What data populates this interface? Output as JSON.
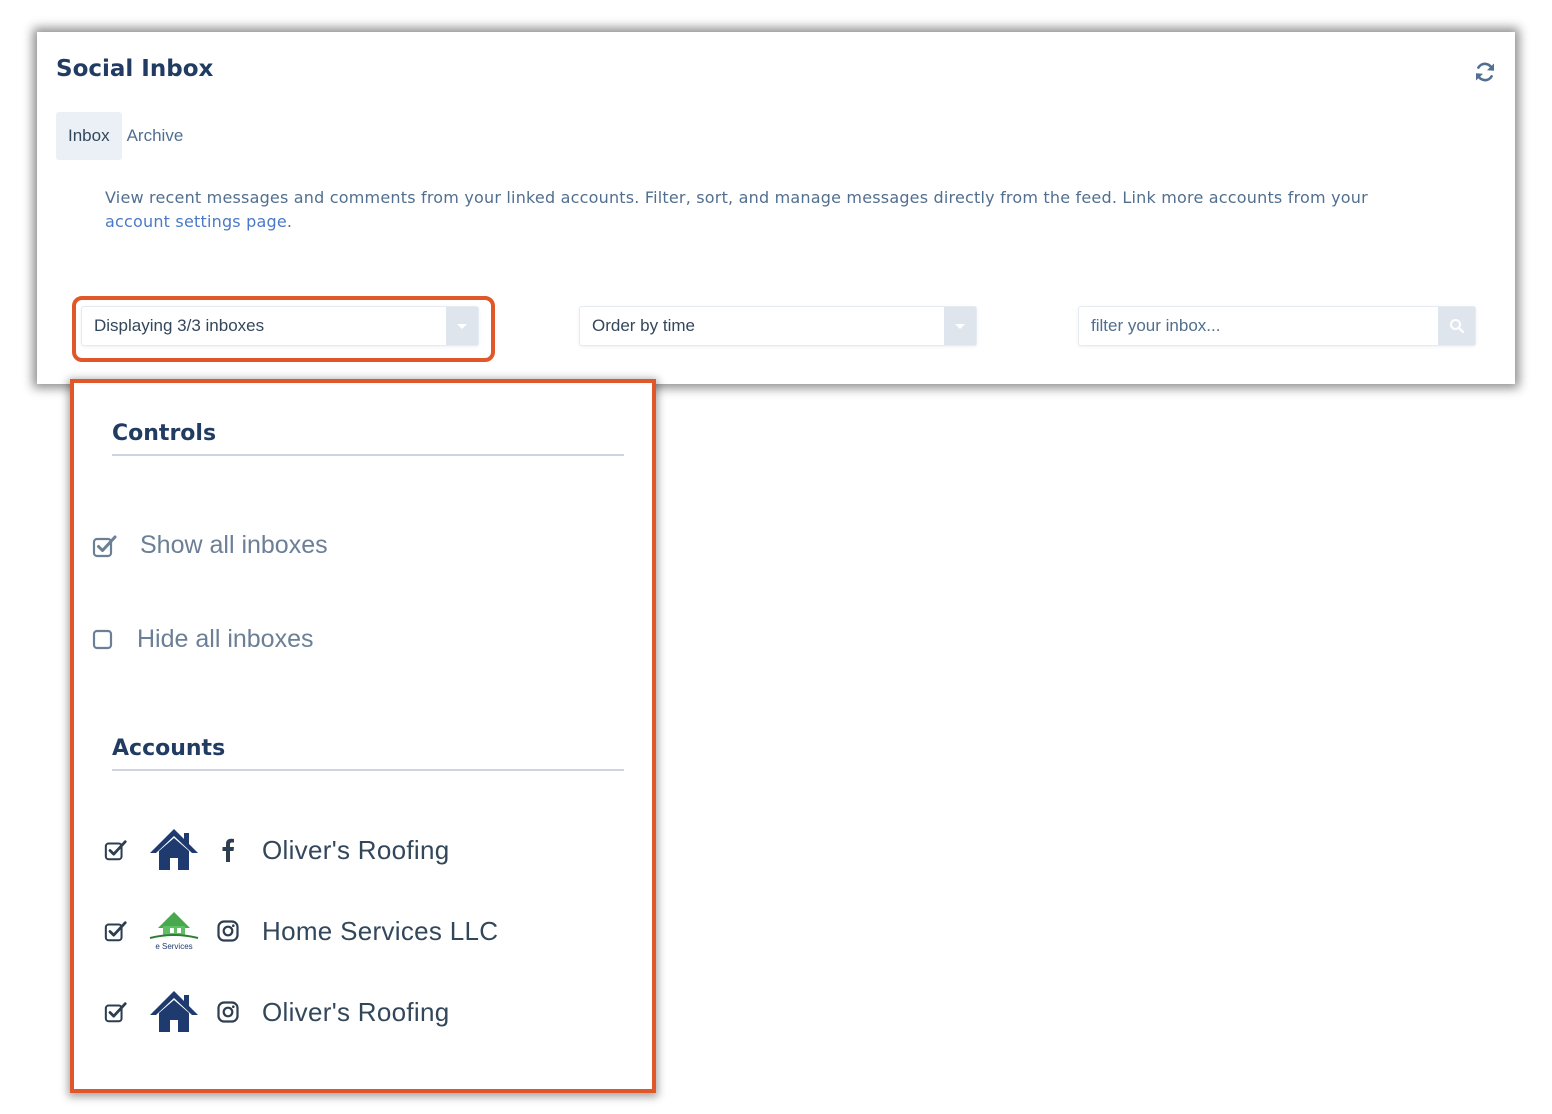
{
  "header": {
    "title": "Social Inbox",
    "refresh_icon": "refresh-icon"
  },
  "tabs": [
    {
      "label": "Inbox",
      "active": true
    },
    {
      "label": "Archive",
      "active": false
    }
  ],
  "description": {
    "text": "View recent messages and comments from your linked accounts. Filter, sort, and manage messages directly from the feed. Link more accounts from your ",
    "link_text": "account settings page",
    "suffix": "."
  },
  "filters": {
    "inbox_select": "Displaying 3/3 inboxes",
    "order_select": "Order by time",
    "search_placeholder": "filter your inbox..."
  },
  "dropdown": {
    "controls_title": "Controls",
    "controls": [
      {
        "label": "Show all inboxes",
        "checked": true
      },
      {
        "label": "Hide all inboxes",
        "checked": false
      }
    ],
    "accounts_title": "Accounts",
    "accounts": [
      {
        "label": "Oliver's Roofing",
        "network": "facebook-icon",
        "avatar": "house-logo",
        "checked": true
      },
      {
        "label": "Home Services LLC",
        "network": "instagram-icon",
        "avatar": "home-services-logo",
        "avatar_caption": "e Services",
        "checked": true
      },
      {
        "label": "Oliver's Roofing",
        "network": "instagram-icon",
        "avatar": "house-logo",
        "checked": true
      }
    ]
  },
  "colors": {
    "highlight": "#e0582a",
    "title": "#213b63",
    "link": "#4a7ac7"
  }
}
